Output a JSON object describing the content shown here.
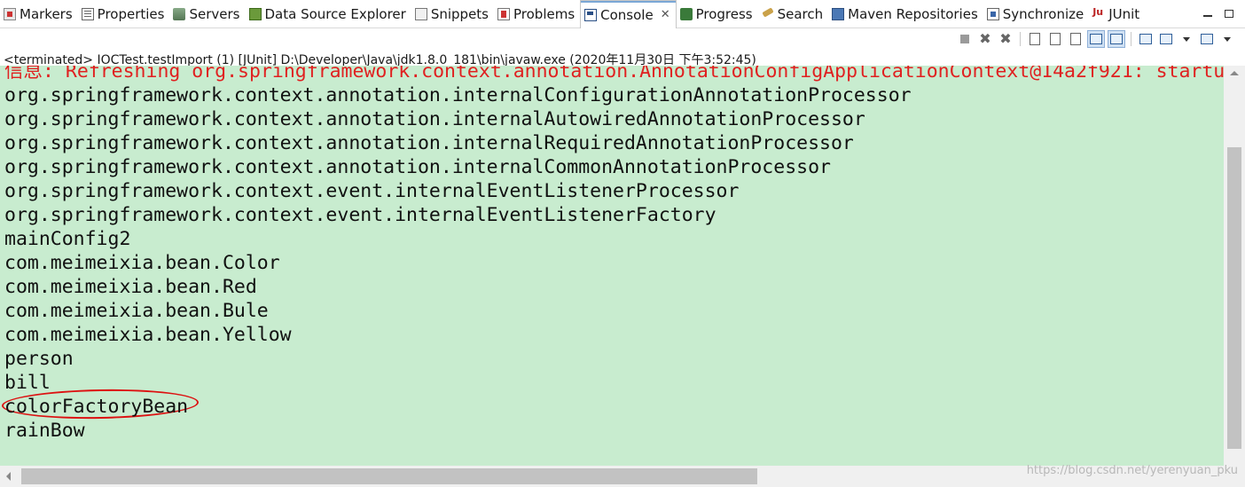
{
  "tabs": [
    {
      "label": "Markers",
      "icon": "markers-icon"
    },
    {
      "label": "Properties",
      "icon": "properties-icon"
    },
    {
      "label": "Servers",
      "icon": "servers-icon"
    },
    {
      "label": "Data Source Explorer",
      "icon": "data-source-explorer-icon"
    },
    {
      "label": "Snippets",
      "icon": "snippets-icon"
    },
    {
      "label": "Problems",
      "icon": "problems-icon"
    },
    {
      "label": "Console",
      "icon": "console-icon",
      "active": true,
      "close": "✕"
    },
    {
      "label": "Progress",
      "icon": "progress-icon"
    },
    {
      "label": "Search",
      "icon": "search-icon"
    },
    {
      "label": "Maven Repositories",
      "icon": "maven-repositories-icon"
    },
    {
      "label": "Synchronize",
      "icon": "synchronize-icon"
    },
    {
      "label": "JUnit",
      "icon": "junit-icon"
    }
  ],
  "process_label": "<terminated> IOCTest.testImport (1) [JUnit] D:\\Developer\\Java\\jdk1.8.0_181\\bin\\javaw.exe (2020年11月30日 下午3:52:45)",
  "console": {
    "background": "#c8eccf",
    "error_color": "#e02020",
    "lines": [
      {
        "text": "信息: Refreshing org.springframework.context.annotation.AnnotationConfigApplicationContext@14a2f921: startu",
        "type": "err"
      },
      {
        "text": "org.springframework.context.annotation.internalConfigurationAnnotationProcessor",
        "type": "out"
      },
      {
        "text": "org.springframework.context.annotation.internalAutowiredAnnotationProcessor",
        "type": "out"
      },
      {
        "text": "org.springframework.context.annotation.internalRequiredAnnotationProcessor",
        "type": "out"
      },
      {
        "text": "org.springframework.context.annotation.internalCommonAnnotationProcessor",
        "type": "out"
      },
      {
        "text": "org.springframework.context.event.internalEventListenerProcessor",
        "type": "out"
      },
      {
        "text": "org.springframework.context.event.internalEventListenerFactory",
        "type": "out"
      },
      {
        "text": "mainConfig2",
        "type": "out"
      },
      {
        "text": "com.meimeixia.bean.Color",
        "type": "out"
      },
      {
        "text": "com.meimeixia.bean.Red",
        "type": "out"
      },
      {
        "text": "com.meimeixia.bean.Bule",
        "type": "out"
      },
      {
        "text": "com.meimeixia.bean.Yellow",
        "type": "out"
      },
      {
        "text": "person",
        "type": "out"
      },
      {
        "text": "bill",
        "type": "out"
      },
      {
        "text": "colorFactoryBean",
        "type": "out",
        "circled": true
      },
      {
        "text": "rainBow",
        "type": "out"
      }
    ]
  },
  "watermark": "https://blog.csdn.net/yerenyuan_pku"
}
